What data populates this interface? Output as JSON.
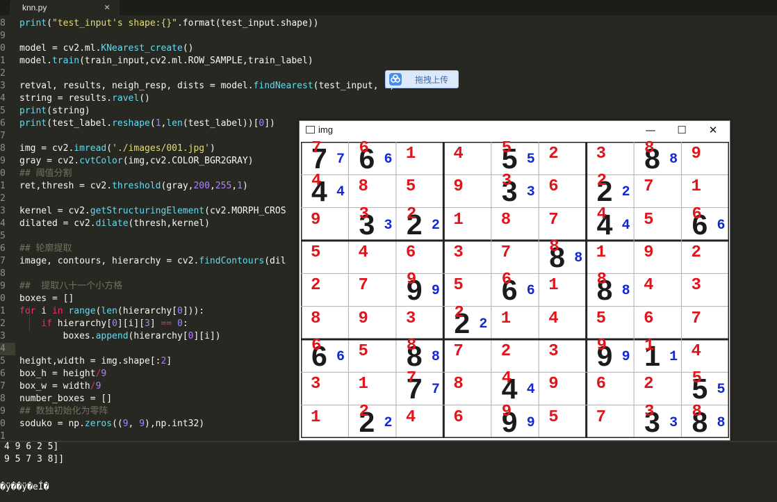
{
  "tab": {
    "title": "knn.py"
  },
  "code": [
    {
      "ln": "8",
      "t": [
        [
          "f",
          "print"
        ],
        [
          "",
          "("
        ],
        [
          "s",
          "\"test_input's shape:{}\""
        ],
        [
          "",
          ".format(test_input.shape)"
        ],
        [
          "",
          ")"
        ]
      ]
    },
    {
      "ln": "9",
      "t": []
    },
    {
      "ln": "0",
      "t": [
        [
          "",
          "model = cv2.ml."
        ],
        [
          "f",
          "KNearest_create"
        ],
        [
          "",
          "()"
        ]
      ]
    },
    {
      "ln": "1",
      "t": [
        [
          "",
          "model."
        ],
        [
          "f",
          "train"
        ],
        [
          "",
          "(train_input,cv2.ml.ROW_SAMPLE,train_label)"
        ]
      ]
    },
    {
      "ln": "2",
      "t": []
    },
    {
      "ln": "3",
      "t": [
        [
          "",
          "retval, results, neigh_resp, dists = model."
        ],
        [
          "f",
          "findNearest"
        ],
        [
          "",
          "(test_input, "
        ],
        [
          "n",
          "1"
        ],
        [
          "",
          ")"
        ]
      ]
    },
    {
      "ln": "4",
      "t": [
        [
          "",
          "string = results."
        ],
        [
          "f",
          "ravel"
        ],
        [
          "",
          "()"
        ]
      ]
    },
    {
      "ln": "5",
      "t": [
        [
          "f",
          "print"
        ],
        [
          "",
          "(string)"
        ]
      ]
    },
    {
      "ln": "6",
      "t": [
        [
          "f",
          "print"
        ],
        [
          "",
          "(test_label."
        ],
        [
          "f",
          "reshape"
        ],
        [
          "",
          "("
        ],
        [
          "n",
          "1"
        ],
        [
          "",
          ","
        ],
        [
          "f",
          "len"
        ],
        [
          "",
          "(test_label))["
        ],
        [
          "n",
          "0"
        ],
        [
          "",
          "])"
        ]
      ]
    },
    {
      "ln": "7",
      "t": []
    },
    {
      "ln": "8",
      "t": [
        [
          "",
          "img = cv2."
        ],
        [
          "f",
          "imread"
        ],
        [
          "",
          "("
        ],
        [
          "s",
          "'./images/001.jpg'"
        ],
        [
          "",
          ")"
        ]
      ]
    },
    {
      "ln": "9",
      "t": [
        [
          "",
          "gray = cv2."
        ],
        [
          "f",
          "cvtColor"
        ],
        [
          "",
          "(img,cv2.COLOR_BGR2GRAY)"
        ]
      ]
    },
    {
      "ln": "0",
      "t": [
        [
          "c",
          "## 阈值分割"
        ]
      ]
    },
    {
      "ln": "1",
      "t": [
        [
          "",
          "ret,thresh = cv2."
        ],
        [
          "f",
          "threshold"
        ],
        [
          "",
          "(gray,"
        ],
        [
          "n",
          "200"
        ],
        [
          "",
          ","
        ],
        [
          "n",
          "255"
        ],
        [
          "",
          ","
        ],
        [
          "n",
          "1"
        ],
        [
          "",
          ")"
        ]
      ]
    },
    {
      "ln": "2",
      "t": []
    },
    {
      "ln": "3",
      "t": [
        [
          "",
          "kernel = cv2."
        ],
        [
          "f",
          "getStructuringElement"
        ],
        [
          "",
          "(cv2.MORPH_CROS"
        ]
      ]
    },
    {
      "ln": "4",
      "t": [
        [
          "",
          "dilated = cv2."
        ],
        [
          "f",
          "dilate"
        ],
        [
          "",
          "(thresh,kernel)"
        ]
      ]
    },
    {
      "ln": "5",
      "t": []
    },
    {
      "ln": "6",
      "t": [
        [
          "c",
          "## 轮廓提取"
        ]
      ]
    },
    {
      "ln": "7",
      "t": [
        [
          "",
          "image, contours, hierarchy = cv2."
        ],
        [
          "f",
          "findContours"
        ],
        [
          "",
          "(dil"
        ]
      ]
    },
    {
      "ln": "8",
      "t": []
    },
    {
      "ln": "9",
      "t": [
        [
          "c",
          "##  提取八十一个小方格"
        ]
      ]
    },
    {
      "ln": "0",
      "t": [
        [
          "",
          "boxes = []"
        ]
      ]
    },
    {
      "ln": "1",
      "t": [
        [
          "k",
          "for"
        ],
        [
          "",
          " i "
        ],
        [
          "k",
          "in"
        ],
        [
          "f",
          " range"
        ],
        [
          "",
          "("
        ],
        [
          "f",
          "len"
        ],
        [
          "",
          "(hierarchy["
        ],
        [
          "n",
          "0"
        ],
        [
          "",
          "])):"
        ]
      ]
    },
    {
      "ln": "2",
      "t": [
        [
          "",
          "    "
        ],
        [
          "k",
          "if"
        ],
        [
          "",
          "",
          " hierarchy["
        ],
        [
          "n",
          "0"
        ],
        [
          "",
          "][i]["
        ],
        [
          "n",
          "3"
        ],
        [
          "",
          "] "
        ],
        [
          "k",
          "=="
        ],
        [
          "",
          "",
          " "
        ],
        [
          "n",
          "0"
        ],
        [
          "",
          ":"
        ]
      ]
    },
    {
      "ln": "3",
      "t": [
        [
          "",
          "        boxes."
        ],
        [
          "f",
          "append"
        ],
        [
          "",
          "(hierarchy["
        ],
        [
          "n",
          "0"
        ],
        [
          "",
          "][i])"
        ]
      ]
    },
    {
      "ln": "4",
      "t": [],
      "cursor": true
    },
    {
      "ln": "5",
      "t": [
        [
          "",
          "height,width = img.shape[:"
        ],
        [
          "n",
          "2"
        ],
        [
          "",
          "]"
        ]
      ]
    },
    {
      "ln": "6",
      "t": [
        [
          "",
          "box_h = height"
        ],
        [
          "k",
          "/"
        ],
        [
          "n",
          "9"
        ]
      ]
    },
    {
      "ln": "7",
      "t": [
        [
          "",
          "box_w = width"
        ],
        [
          "k",
          "/"
        ],
        [
          "n",
          "9"
        ]
      ]
    },
    {
      "ln": "8",
      "t": [
        [
          "",
          "number_boxes = []"
        ]
      ]
    },
    {
      "ln": "9",
      "t": [
        [
          "c",
          "## 数独初始化为零阵"
        ]
      ]
    },
    {
      "ln": "0",
      "t": [
        [
          "",
          "soduko = np."
        ],
        [
          "f",
          "zeros"
        ],
        [
          "",
          "(("
        ],
        [
          "n",
          "9"
        ],
        [
          "",
          ", "
        ],
        [
          "n",
          "9"
        ],
        [
          "",
          "),np.int32)"
        ]
      ]
    },
    {
      "ln": "1",
      "t": []
    }
  ],
  "output": [
    "4 9 6 2 5]",
    "9 5 7 3 8]]",
    "",
    "�ÿ��ÿ�eÍ�"
  ],
  "upload": {
    "label": "拖拽上传"
  },
  "window": {
    "title": "img",
    "minimize": "—",
    "maximize": "☐",
    "close": "✕"
  },
  "sudoku": {
    "rows": [
      [
        {
          "d": "7",
          "b": "7"
        },
        {
          "d": "6",
          "b": "6"
        },
        {
          "d": "1"
        },
        {
          "d": "4"
        },
        {
          "d": "5",
          "b": "5"
        },
        {
          "d": "2"
        },
        {
          "d": "3"
        },
        {
          "d": "8",
          "b": "8"
        },
        {
          "d": "9"
        }
      ],
      [
        {
          "d": "4",
          "b": "4"
        },
        {
          "d": "8"
        },
        {
          "d": "5"
        },
        {
          "d": "9"
        },
        {
          "d": "3",
          "b": "3"
        },
        {
          "d": "6"
        },
        {
          "d": "2",
          "b": "2"
        },
        {
          "d": "7"
        },
        {
          "d": "1"
        }
      ],
      [
        {
          "d": "9"
        },
        {
          "d": "3",
          "b": "3"
        },
        {
          "d": "2",
          "b": "2"
        },
        {
          "d": "1"
        },
        {
          "d": "8"
        },
        {
          "d": "7"
        },
        {
          "d": "4",
          "b": "4"
        },
        {
          "d": "5"
        },
        {
          "d": "6",
          "b": "6"
        }
      ],
      [
        {
          "d": "5"
        },
        {
          "d": "4"
        },
        {
          "d": "6"
        },
        {
          "d": "3"
        },
        {
          "d": "7"
        },
        {
          "d": "8",
          "b": "8"
        },
        {
          "d": "1"
        },
        {
          "d": "9"
        },
        {
          "d": "2"
        }
      ],
      [
        {
          "d": "2"
        },
        {
          "d": "7"
        },
        {
          "d": "9",
          "b": "9"
        },
        {
          "d": "5"
        },
        {
          "d": "6",
          "b": "6"
        },
        {
          "d": "1"
        },
        {
          "d": "8",
          "b": "8"
        },
        {
          "d": "4"
        },
        {
          "d": "3"
        }
      ],
      [
        {
          "d": "8"
        },
        {
          "d": "9"
        },
        {
          "d": "3"
        },
        {
          "d": "2",
          "b": "2"
        },
        {
          "d": "1"
        },
        {
          "d": "4"
        },
        {
          "d": "5"
        },
        {
          "d": "6"
        },
        {
          "d": "7"
        }
      ],
      [
        {
          "d": "6",
          "b": "6"
        },
        {
          "d": "5"
        },
        {
          "d": "8",
          "b": "8"
        },
        {
          "d": "7"
        },
        {
          "d": "2"
        },
        {
          "d": "3"
        },
        {
          "d": "9",
          "b": "9"
        },
        {
          "d": "1",
          "b": "1"
        },
        {
          "d": "4"
        }
      ],
      [
        {
          "d": "3"
        },
        {
          "d": "1"
        },
        {
          "d": "7",
          "b": "7"
        },
        {
          "d": "8"
        },
        {
          "d": "4",
          "b": "4"
        },
        {
          "d": "9"
        },
        {
          "d": "6"
        },
        {
          "d": "2"
        },
        {
          "d": "5",
          "b": "5"
        }
      ],
      [
        {
          "d": "1"
        },
        {
          "d": "2",
          "b": "2"
        },
        {
          "d": "4"
        },
        {
          "d": "6"
        },
        {
          "d": "9",
          "b": "9"
        },
        {
          "d": "5"
        },
        {
          "d": "7"
        },
        {
          "d": "3",
          "b": "3"
        },
        {
          "d": "8",
          "b": "8"
        }
      ]
    ]
  }
}
